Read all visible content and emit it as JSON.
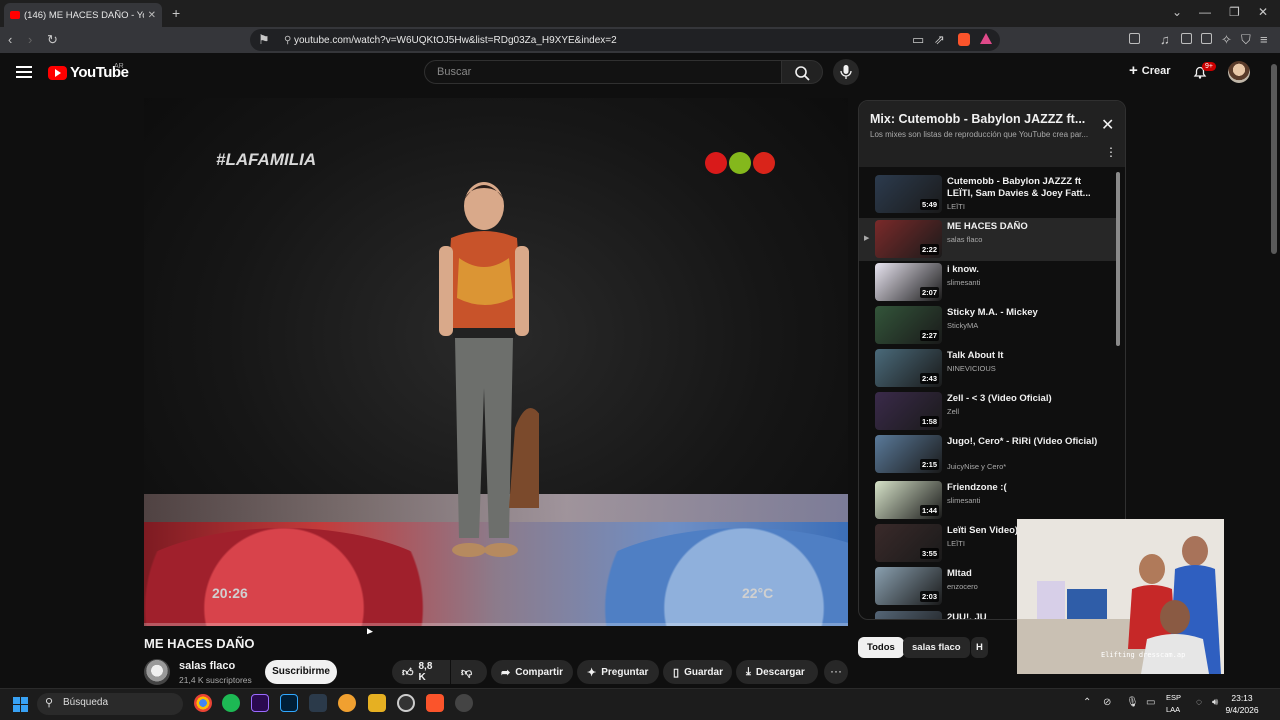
{
  "browser": {
    "tab_title": "(146) ME HACES DAÑO - You",
    "url": "youtube.com/watch?v=W6UQKtOJ5Hw&list=RDg03Za_H9XYE&index=2",
    "new_tab_glyph": "+",
    "window_controls": [
      "⌄",
      "—",
      "❐",
      "✕"
    ]
  },
  "youtube": {
    "logo_text": "YouTube",
    "country_code": "AR",
    "search_placeholder": "Buscar",
    "create_label": "Crear",
    "notification_count": "9+"
  },
  "video": {
    "overlay_hashtag": "#LAFAMILIA",
    "overlay_time": "20:26",
    "overlay_temp": "22°C",
    "title": "ME HACES DAÑO",
    "channel": "salas flaco",
    "subscribers": "21,4 K suscriptores",
    "subscribe_label": "Suscribirme",
    "likes": "8,8 K",
    "share_label": "Compartir",
    "ask_label": "Preguntar",
    "save_label": "Guardar",
    "download_label": "Descargar",
    "more_glyph": "···",
    "progress_fraction": 0.0
  },
  "playlist": {
    "title": "Mix: Cutemobb - Babylon JAZZZ ft...",
    "subtitle": "Los mixes son listas de reproducción que YouTube crea par...",
    "items": [
      {
        "title": "Cutemobb - Babylon JAZZZ ft LEÏTI, Sam Davies & Joey Fatt...",
        "channel": "LEÏTI",
        "duration": "5:49"
      },
      {
        "title": "ME HACES DAÑO",
        "channel": "salas flaco",
        "duration": "2:22",
        "active": true
      },
      {
        "title": "i know.",
        "channel": "slimesanti",
        "duration": "2:07"
      },
      {
        "title": "Sticky M.A. - Mickey",
        "channel": "StickyMA",
        "duration": "2:27"
      },
      {
        "title": "Talk About It",
        "channel": "NINEVICIOUS",
        "duration": "2:43"
      },
      {
        "title": "Zell - < 3 (Video Oficial)",
        "channel": "Zell",
        "duration": "1:58"
      },
      {
        "title": "Jugo!, Cero* - RiRi (Video Oficial)",
        "channel": "JuicyNise y Cero*",
        "duration": "2:15"
      },
      {
        "title": "Friendzone :(",
        "channel": "slimesanti",
        "duration": "1:44"
      },
      {
        "title": "Leïti Sen Video)",
        "channel": "LEÏTI",
        "duration": "3:55"
      },
      {
        "title": "MItad",
        "channel": "enzocero",
        "duration": "2:03"
      },
      {
        "title": "2UU!, JU",
        "channel": "",
        "duration": ""
      }
    ],
    "playing_glyph": "▶"
  },
  "chips": [
    "Todos",
    "salas flaco",
    "H"
  ],
  "webcam_label": "Elifting dresscam.ap",
  "taskbar": {
    "search_label": "Búsqueda",
    "lang_top": "ESP",
    "lang_bottom": "LAA",
    "time": "23:13",
    "date": "9/4/2026"
  },
  "colors": {
    "accent_red": "#ff0000",
    "background": "#0f0f0f",
    "surface": "#272727"
  }
}
